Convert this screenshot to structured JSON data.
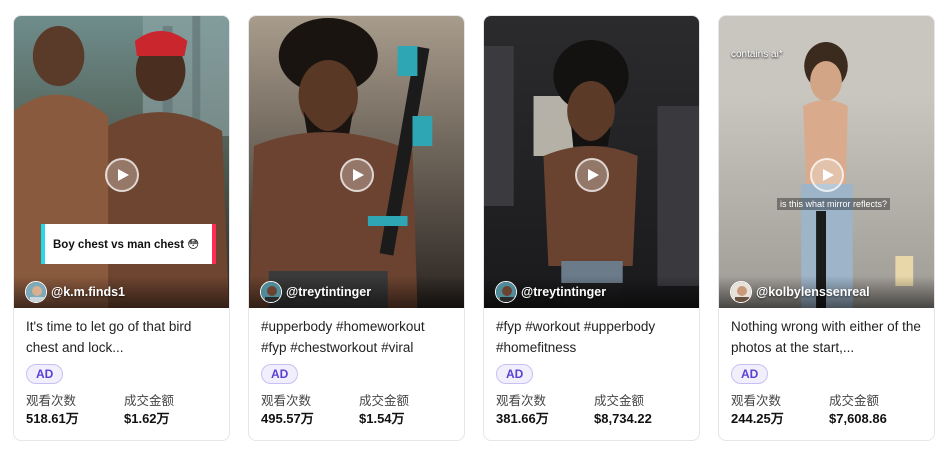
{
  "cards": [
    {
      "handle": "@k.m.finds1",
      "description": "It's time to let go of that bird chest and lock...",
      "ad_label": "AD",
      "overlay_text": "Boy chest vs man chest 😳",
      "views_label": "观看次数",
      "views_value": "518.61万",
      "gmv_label": "成交金额",
      "gmv_value": "$1.62万"
    },
    {
      "handle": "@treytintinger",
      "description": "#upperbody #homeworkout #fyp #chestworkout #viral",
      "ad_label": "AD",
      "views_label": "观看次数",
      "views_value": "495.57万",
      "gmv_label": "成交金额",
      "gmv_value": "$1.54万"
    },
    {
      "handle": "@treytintinger",
      "description": "#fyp #workout #upperbody #homefitness",
      "ad_label": "AD",
      "views_label": "观看次数",
      "views_value": "381.66万",
      "gmv_label": "成交金额",
      "gmv_value": "$8,734.22"
    },
    {
      "handle": "@kolbylenssenreal",
      "description": "Nothing wrong with either of the photos at the start,...",
      "ad_label": "AD",
      "ai_tag": "contains ai*",
      "mirror_text": "is this what mirror reflects?",
      "views_label": "观看次数",
      "views_value": "244.25万",
      "gmv_label": "成交金额",
      "gmv_value": "$7,608.86"
    }
  ],
  "icons": {
    "play": "play-icon"
  },
  "colors": {
    "ad_text": "#5b3fd6",
    "ad_bg": "#f2effd",
    "overlay_cyan": "#25d9e8",
    "overlay_red": "#fe2c55"
  }
}
